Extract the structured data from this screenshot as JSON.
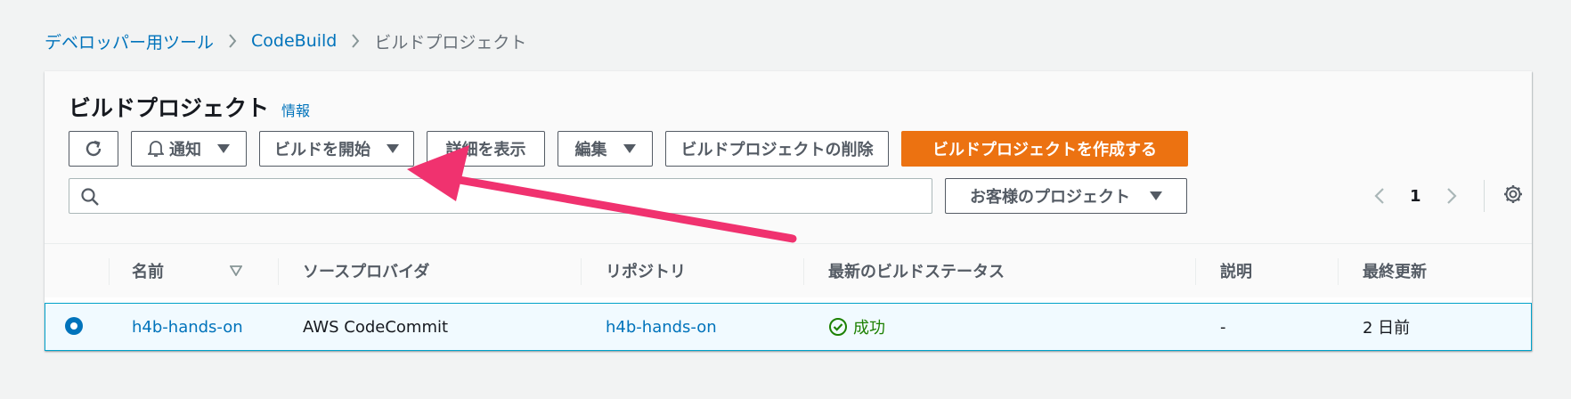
{
  "breadcrumb": {
    "items": [
      {
        "label": "デベロッパー用ツール"
      },
      {
        "label": "CodeBuild"
      }
    ],
    "current": "ビルドプロジェクト"
  },
  "panel": {
    "title": "ビルドプロジェクト",
    "info_link": "情報"
  },
  "toolbar": {
    "notify_label": "通知",
    "start_build_label": "ビルドを開始",
    "view_details_label": "詳細を表示",
    "edit_label": "編集",
    "delete_label": "ビルドプロジェクトの削除",
    "create_label": "ビルドプロジェクトを作成する"
  },
  "search": {
    "value": "",
    "placeholder": ""
  },
  "filter": {
    "selected": "お客様のプロジェクト"
  },
  "pagination": {
    "current_page": "1"
  },
  "table": {
    "columns": [
      "名前",
      "ソースプロバイダ",
      "リポジトリ",
      "最新のビルドステータス",
      "説明",
      "最終更新"
    ],
    "rows": [
      {
        "name": "h4b-hands-on",
        "source_provider": "AWS CodeCommit",
        "repository": "h4b-hands-on",
        "status": "成功",
        "description": "-",
        "last_modified": "2 日前"
      }
    ]
  },
  "colors": {
    "link": "#0073bb",
    "primary": "#ec7211",
    "success": "#1d8102",
    "annotation_arrow": "#f0326f"
  }
}
